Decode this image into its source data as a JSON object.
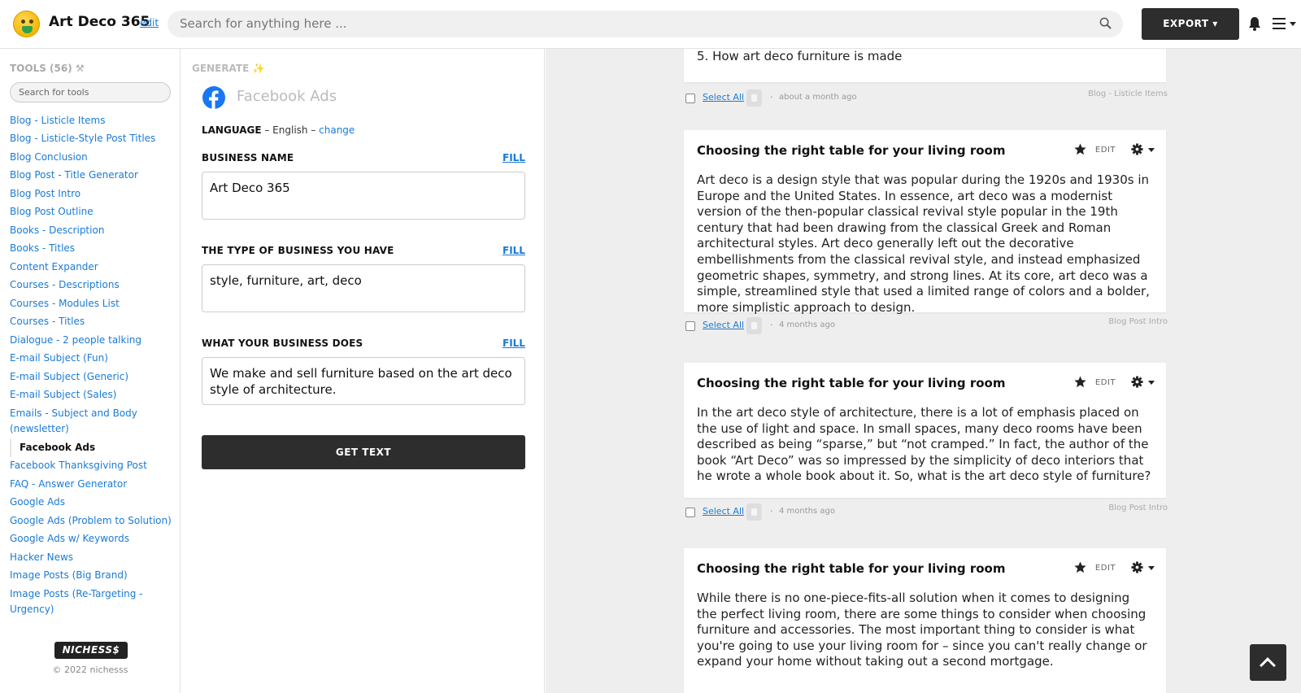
{
  "header": {
    "app_title": "Art Deco 365",
    "edit_label": "edit",
    "search_placeholder": "Search for anything here ...",
    "export_label": "EXPORT"
  },
  "sidebar": {
    "heading": "TOOLS (56) ⚒",
    "search_placeholder": "Search for tools",
    "items": [
      "Blog - Listicle Items",
      "Blog - Listicle-Style Post Titles",
      "Blog Conclusion",
      "Blog Post - Title Generator",
      "Blog Post Intro",
      "Blog Post Outline",
      "Books - Description",
      "Books - Titles",
      "Content Expander",
      "Courses - Descriptions",
      "Courses - Modules List",
      "Courses - Titles",
      "Dialogue - 2 people talking",
      "E-mail Subject (Fun)",
      "E-mail Subject (Generic)",
      "E-mail Subject (Sales)",
      "Emails - Subject and Body (newsletter)",
      "Facebook Ads",
      "Facebook Thanksgiving Post",
      "FAQ - Answer Generator",
      "Google Ads",
      "Google Ads (Problem to Solution)",
      "Google Ads w/ Keywords",
      "Hacker News",
      "Image Posts (Big Brand)",
      "Image Posts (Re-Targeting - Urgency)"
    ],
    "active_item": "Facebook Ads",
    "brand_logo_text": "NICHESS$",
    "copyright": "© 2022 nichesss"
  },
  "generate": {
    "heading": "GENERATE ✨",
    "tool_name": "Facebook Ads",
    "language_label": "LANGUAGE",
    "language_value": " – English – ",
    "language_change": "change",
    "fields": [
      {
        "label": "BUSINESS NAME",
        "fill": "FILL",
        "value": "Art Deco 365"
      },
      {
        "label": "THE TYPE OF BUSINESS YOU HAVE",
        "fill": "FILL",
        "value": "style, furniture, art, deco"
      },
      {
        "label": "WHAT YOUR BUSINESS DOES",
        "fill": "FILL",
        "value": "We make and sell furniture based on the art deco style of architecture."
      }
    ],
    "button_label": "GET TEXT"
  },
  "results": {
    "partial_card": {
      "body": "5. How art deco furniture is made"
    },
    "cards": [
      {
        "title": "Choosing the right table for your living room",
        "edit_label": "EDIT",
        "body": "Art deco is a design style that was popular during the 1920s and 1930s in Europe and the United States. In essence, art deco was a modernist version of the then-popular classical revival style popular in the 19th century that had been drawing from the classical Greek and Roman architectural styles. Art deco generally left out the decorative embellishments from the classical revival style, and instead emphasized geometric shapes, symmetry, and strong lines. At its core, art deco was a simple, streamlined style that used a limited range of colors and a bolder, more simplistic approach to design."
      },
      {
        "title": "Choosing the right table for your living room",
        "edit_label": "EDIT",
        "body": "In the art deco style of architecture, there is a lot of emphasis placed on the use of light and space. In small spaces, many deco rooms have been described as being “sparse,” but “not cramped.” In fact, the author of the book “Art Deco” was so impressed by the simplicity of deco interiors that he wrote a whole book about it. So, what is the art deco style of furniture?"
      },
      {
        "title": "Choosing the right table for your living room",
        "edit_label": "EDIT",
        "body": "While there is no one-piece-fits-all solution when it comes to designing the perfect living room, there are some things to consider when choosing furniture and accessories. The most important thing to consider is what you're going to use your living room for – since you can't really change or expand your home without taking out a second mortgage."
      }
    ],
    "metas": [
      {
        "select_all": "Select All",
        "dot": "·",
        "ago": "about a month ago",
        "tag": "Blog - Listicle Items"
      },
      {
        "select_all": "Select All",
        "dot": "·",
        "ago": "4 months ago",
        "tag": "Blog Post Intro"
      },
      {
        "select_all": "Select All",
        "dot": "·",
        "ago": "4 months ago",
        "tag": "Blog Post Intro"
      }
    ]
  },
  "colors": {
    "link": "#1a7bd6",
    "dark_button": "#2d2d2d",
    "results_bg": "#eeeeee",
    "facebook_blue": "#1877f2"
  }
}
